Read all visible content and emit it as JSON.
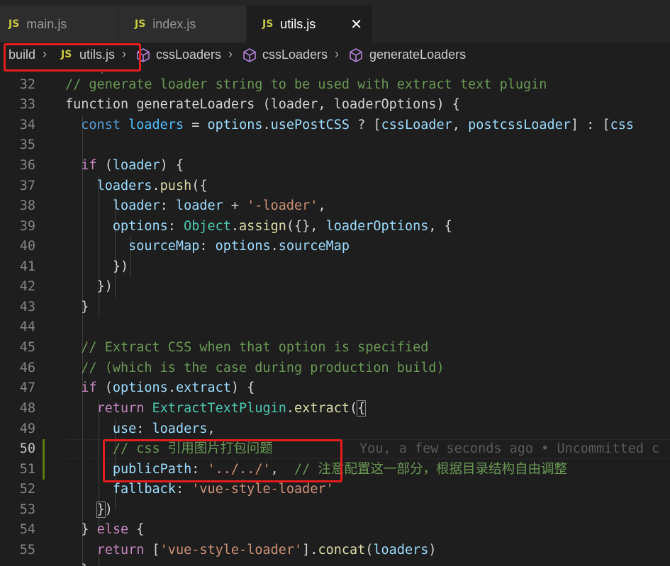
{
  "tabs": [
    {
      "badge": "JS",
      "label": "main.js"
    },
    {
      "badge": "JS",
      "label": "index.js"
    },
    {
      "badge": "JS",
      "label": "utils.js",
      "close": "✕"
    }
  ],
  "breadcrumb": {
    "folder": "build",
    "file_badge": "JS",
    "file": "utils.js",
    "symbols": [
      "cssLoaders",
      "cssLoaders",
      "generateLoaders"
    ]
  },
  "editor": {
    "line_numbers": [
      "32",
      "33",
      "34",
      "35",
      "36",
      "37",
      "38",
      "39",
      "40",
      "41",
      "42",
      "43",
      "44",
      "45",
      "46",
      "47",
      "48",
      "49",
      "50",
      "51",
      "52",
      "53",
      "54",
      "55"
    ],
    "lines": [
      "// generate loader string to be used with extract text plugin",
      "function generateLoaders (loader, loaderOptions) {",
      "  const loaders = options.usePostCSS ? [cssLoader, postcssLoader] : [css",
      "",
      "  if (loader) {",
      "    loaders.push({",
      "      loader: loader + '-loader',",
      "      options: Object.assign({}, loaderOptions, {",
      "        sourceMap: options.sourceMap",
      "      })",
      "    })",
      "  }",
      "",
      "  // Extract CSS when that option is specified",
      "  // (which is the case during production build)",
      "  if (options.extract) {",
      "    return ExtractTextPlugin.extract({",
      "      use: loaders,",
      "      // css 引用图片打包问题",
      "      publicPath: '../../',  // 注意配置这一部分，根据目录结构自由调整",
      "      fallback: 'vue-style-loader'",
      "    })",
      "  } else {",
      "    return ['vue-style-loader'].concat(loaders)"
    ],
    "blame": "You, a few seconds ago • Uncommitted c"
  },
  "colors": {
    "keyword": "#569cd6",
    "control": "#c586c0",
    "function": "#dcdcaa",
    "variable": "#9cdcfe",
    "string": "#ce9178",
    "comment": "#6a9955",
    "highlight_box": "#e51d1d",
    "git_modified": "#587c0c"
  }
}
